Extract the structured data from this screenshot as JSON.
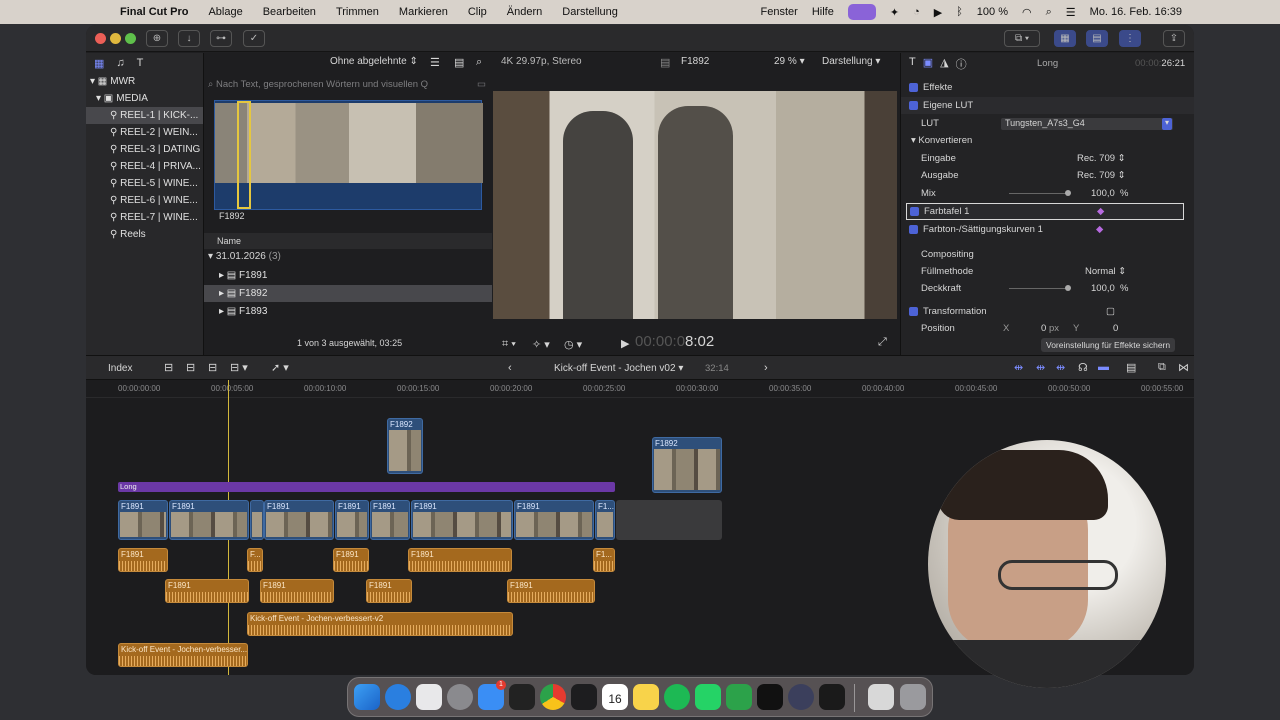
{
  "menubar": {
    "app": "Final Cut Pro",
    "items": [
      "Ablage",
      "Bearbeiten",
      "Trimmen",
      "Markieren",
      "Clip",
      "Ändern",
      "Darstellung"
    ],
    "right_items": [
      "Fenster",
      "Hilfe"
    ],
    "battery": "100 %",
    "datetime": "Mo. 16. Feb.  16:39"
  },
  "library": {
    "root": "MWR",
    "event": "MEDIA",
    "items": [
      "REEL-1 | KICK-...",
      "REEL-2 | WEIN...",
      "REEL-3 | DATING",
      "REEL-4 | PRIVA...",
      "REEL-5 | WINE...",
      "REEL-6 | WINE...",
      "REEL-7 | WINE..."
    ],
    "smart": "Reels"
  },
  "browser": {
    "filter": "Ohne abgelehnte",
    "search_placeholder": "Nach Text, gesprochenen Wörtern und visuellen Q",
    "filmstrip_label": "F1892",
    "col_name": "Name",
    "date_group": "31.01.2026",
    "date_count": "(3)",
    "clips": [
      "F1891",
      "F1892",
      "F1893"
    ],
    "status": "1 von 3 ausgewählt, 03:25"
  },
  "viewer": {
    "format": "4K 29.97p, Stereo",
    "clip_name": "F1892",
    "zoom": "29 %",
    "view_menu": "Darstellung",
    "timecode_dim": "00:00:0",
    "timecode": "8:02"
  },
  "inspector": {
    "clip_title": "Long",
    "duration_dim": "00:00:",
    "duration": "26:21",
    "effects_header": "Effekte",
    "lut_effect": "Eigene LUT",
    "lut_label": "LUT",
    "lut_value": "Tungsten_A7s3_G4",
    "convert": "Konvertieren",
    "input_label": "Eingabe",
    "input_value": "Rec. 709",
    "output_label": "Ausgabe",
    "output_value": "Rec. 709",
    "mix_label": "Mix",
    "mix_value": "100,0",
    "mix_unit": "%",
    "color_board": "Farbtafel 1",
    "hue_sat": "Farbton-/Sättigungskurven 1",
    "compositing": "Compositing",
    "blend_label": "Füllmethode",
    "blend_value": "Normal",
    "opacity_label": "Deckkraft",
    "opacity_value": "100,0",
    "opacity_unit": "%",
    "transform": "Transformation",
    "position_label": "Position",
    "pos_x_label": "X",
    "pos_x": "0",
    "pos_unit": "px",
    "pos_y_label": "Y",
    "pos_y": "0",
    "save_preset": "Voreinstellung für Effekte sichern"
  },
  "timeline_header": {
    "index": "Index",
    "project": "Kick-off Event - Jochen v02",
    "duration": "32:14"
  },
  "ruler": [
    "00:00:00:00",
    "00:00:05:00",
    "00:00:10:00",
    "00:00:15:00",
    "00:00:20:00",
    "00:00:25:00",
    "00:00:30:00",
    "00:00:35:00",
    "00:00:40:00",
    "00:00:45:00",
    "00:00:50:00",
    "00:00:55:00"
  ],
  "timeline": {
    "title_clip": "Long",
    "connected1": "F1892",
    "connected2": "F1892",
    "primary": [
      "F1891",
      "F1891",
      "F1891",
      "F1891",
      "F1891",
      "F1891",
      "F1891",
      "F1..."
    ],
    "audio1": [
      "F1891",
      "F...",
      "F1891",
      "F1891",
      "F1..."
    ],
    "audio2": [
      "F1891",
      "F1891",
      "F1891",
      "F1891"
    ],
    "music1": "Kick-off Event - Jochen-verbessert-v2",
    "music2": "Kick-off Event - Jochen-verbesser..."
  },
  "dock_badge": "1",
  "dock_date": "16"
}
